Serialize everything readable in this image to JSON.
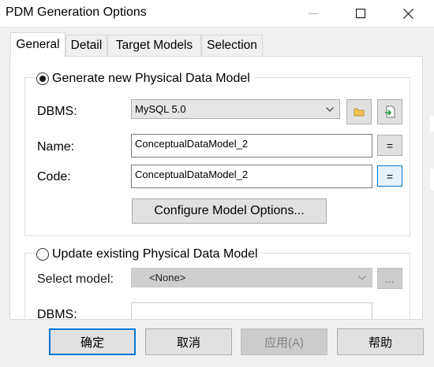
{
  "window": {
    "title": "PDM Generation Options"
  },
  "tabs": [
    {
      "label": "General",
      "active": true
    },
    {
      "label": "Detail",
      "active": false
    },
    {
      "label": "Target Models",
      "active": false
    },
    {
      "label": "Selection",
      "active": false
    }
  ],
  "generate_group": {
    "label": "Generate new Physical Data Model",
    "selected": true,
    "dbms_label": "DBMS:",
    "dbms_value": "MySQL 5.0",
    "name_label": "Name:",
    "name_value": "ConceptualDataModel_2",
    "code_label": "Code:",
    "code_value": "ConceptualDataModel_2",
    "equals_label": "=",
    "configure_label": "Configure Model Options..."
  },
  "update_group": {
    "label": "Update existing Physical Data Model",
    "selected": false,
    "select_model_label": "Select model:",
    "select_model_value": "<None>",
    "browse_label": "...",
    "dbms_label": "DBMS:",
    "dbms_value": ""
  },
  "footer": {
    "ok_label": "确定",
    "cancel_label": "取消",
    "apply_label": "应用(A)",
    "help_label": "帮助"
  }
}
